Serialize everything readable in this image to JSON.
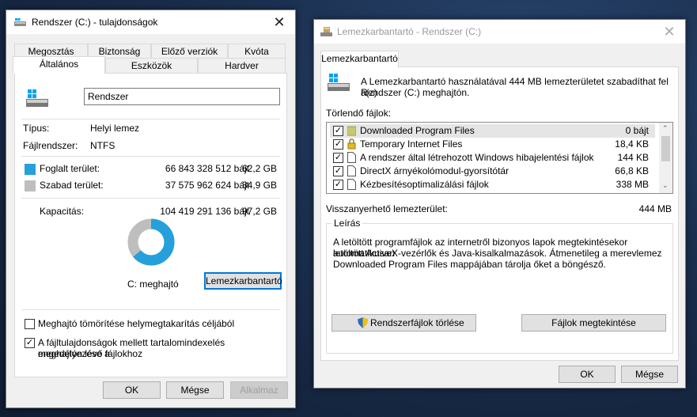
{
  "props": {
    "title": "Rendszer (C:) - tulajdonságok",
    "tabs_row1": [
      "Megosztás",
      "Biztonság",
      "Előző verziók",
      "Kvóta"
    ],
    "tabs_row2": [
      "Általános",
      "Eszközök",
      "Hardver"
    ],
    "drive_name": "Rendszer",
    "type_label": "Típus:",
    "type_value": "Helyi lemez",
    "fs_label": "Fájlrendszer:",
    "fs_value": "NTFS",
    "used_label": "Foglalt terület:",
    "used_bytes": "66 843 328 512 bájt",
    "used_gb": "62,2 GB",
    "free_label": "Szabad terület:",
    "free_bytes": "37 575 962 624 bájt",
    "free_gb": "34,9 GB",
    "cap_label": "Kapacitás:",
    "cap_bytes": "104 419 291 136 bájt",
    "cap_gb": "97,2 GB",
    "used_fraction": 0.64,
    "used_color": "#26a0da",
    "free_color": "#bebebe",
    "drive_label": "C: meghajtó",
    "cleanup_button": "Lemezkarbantartó",
    "compress_label": "Meghajtó tömörítése helymegtakarítás céljából",
    "compress_checked": false,
    "index_label_1": "A fájltulajdonságok mellett tartalomindexelés engedélyezése a",
    "index_label_2": "meghajtón lévő fájlokhoz",
    "index_checked": true,
    "ok": "OK",
    "cancel": "Mégse",
    "apply": "Alkalmaz"
  },
  "cleanup": {
    "title": "Lemezkarbantartó - Rendszer (C:)",
    "tab": "Lemezkarbantartó",
    "intro_1": "A Lemezkarbantartó használatával 444 MB lemezterületet szabadíthat fel a(z)",
    "intro_2": "Rendszer (C:) meghajtón.",
    "files_label": "Törlendő fájlok:",
    "files": [
      {
        "name": "Downloaded Program Files",
        "size": "0 bájt",
        "checked": true,
        "icon": "folder-icon",
        "selected": true
      },
      {
        "name": "Temporary Internet Files",
        "size": "18,4 KB",
        "checked": true,
        "icon": "lock-icon",
        "selected": false
      },
      {
        "name": "A rendszer által létrehozott Windows hibajelentési fájlok",
        "size": "144 KB",
        "checked": true,
        "icon": "file-icon",
        "selected": false
      },
      {
        "name": "DirectX árnyékolómodul-gyorsítótár",
        "size": "66,8 KB",
        "checked": true,
        "icon": "file-icon",
        "selected": false
      },
      {
        "name": "Kézbesítésoptimalizálási fájlok",
        "size": "338 MB",
        "checked": true,
        "icon": "file-icon",
        "selected": false
      }
    ],
    "recover_label": "Visszanyerhető lemezterület:",
    "recover_value": "444 MB",
    "desc_label": "Leírás",
    "desc_1": "A letöltött programfájlok az internetről bizonyos lapok megtekintésekor automatikusan",
    "desc_2": "letöltött ActiveX-vezérlők és Java-kisalkalmazások. Átmenetileg a merevlemez",
    "desc_3": "Downloaded Program Files mappájában tárolja őket a böngésző.",
    "sys_button": "Rendszerfájlok törlése",
    "view_button": "Fájlok megtekintése",
    "ok": "OK",
    "cancel": "Mégse"
  }
}
